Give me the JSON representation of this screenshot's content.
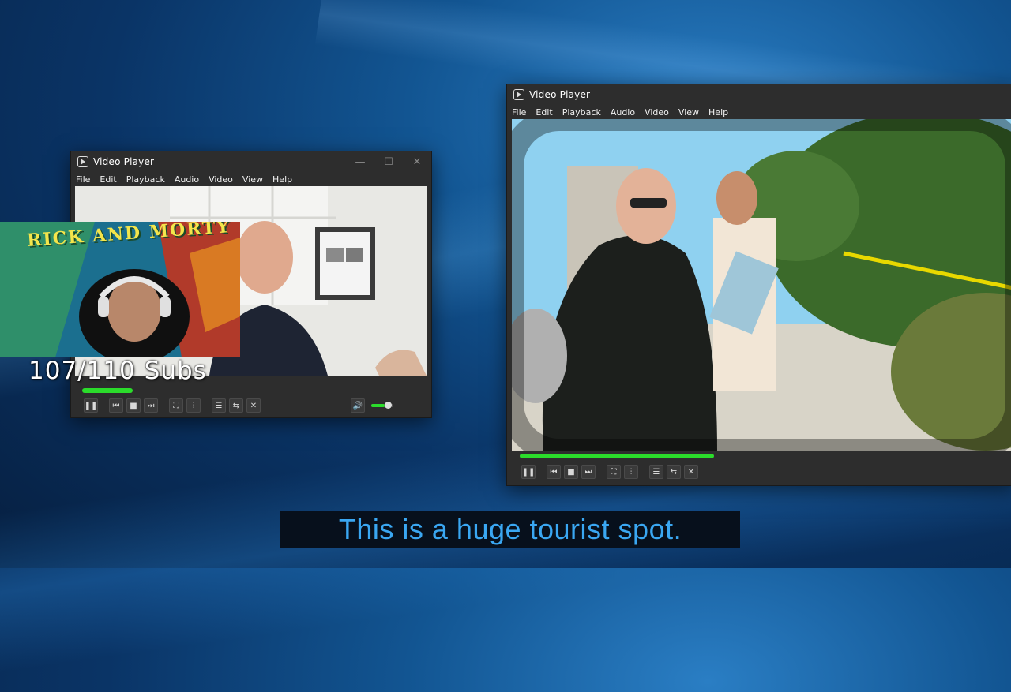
{
  "window_left": {
    "title": "Video Player",
    "menu": [
      "File",
      "Edit",
      "Playback",
      "Audio",
      "Video",
      "View",
      "Help"
    ],
    "controls": {
      "minimize": "—",
      "maximize": "☐",
      "close": "✕"
    },
    "progress_fraction": 0.14,
    "volume_fraction": 0.6
  },
  "window_right": {
    "title": "Video Player",
    "menu": [
      "File",
      "Edit",
      "Playback",
      "Audio",
      "Video",
      "View",
      "Help"
    ],
    "progress_fraction": 0.39
  },
  "icons": {
    "pause": "❚❚",
    "prev": "⏮",
    "stop": "■",
    "next": "⏭",
    "fullscreen": "⛶",
    "equalizer": "⫶",
    "playlist": "☰",
    "loop": "⇆",
    "shuffle": "✕",
    "volume": "🔊"
  },
  "overlay": {
    "webcam_banner": "RICK AND MORTY",
    "sub_count": "107/110 Subs"
  },
  "caption": "This is a huge tourist spot.",
  "colors": {
    "accent_progress": "#2bdc2b",
    "caption_text": "#3aa7f2",
    "caption_bg": "#07101c"
  }
}
